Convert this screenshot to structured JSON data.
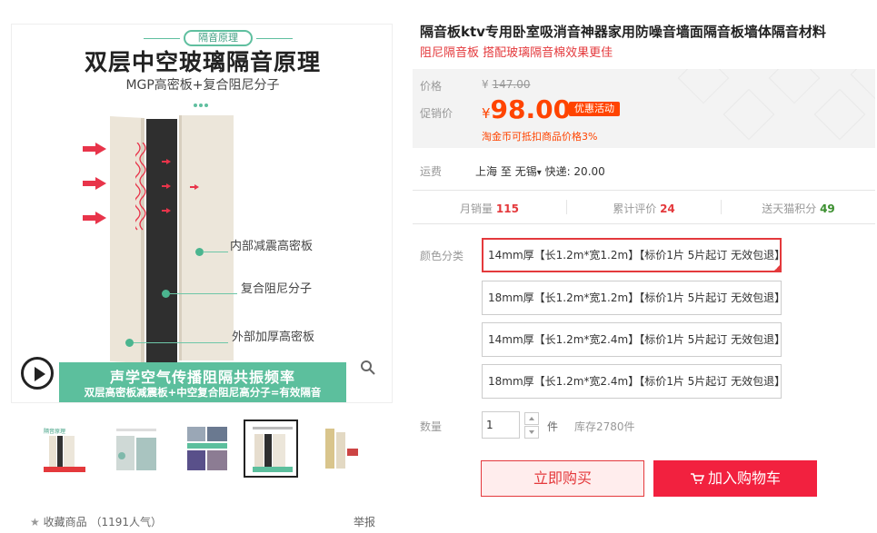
{
  "gallery": {
    "badge": "隔音原理",
    "headline": "双层中空玻璃隔音原理",
    "subheadline": "MGP高密板+复合阻尼分子",
    "labels": [
      "内部减震高密板",
      "复合阻尼分子",
      "外部加厚高密板"
    ],
    "band_line1": "声学空气传播阻隔共振频率",
    "band_line2": "双层高密板减震板+中空复合阻尼高分子=有效隔音",
    "thumb1_caption": "隔音原理",
    "active_thumb_index": 3
  },
  "footer": {
    "favorite_label": "收藏商品",
    "favorite_count": "（1191人气）",
    "report_label": "举报"
  },
  "product": {
    "title": "隔音板ktv专用卧室吸消音神器家用防噪音墙面隔音板墙体隔音材料",
    "subtitle": "阻尼隔音板 搭配玻璃隔音棉效果更佳"
  },
  "price": {
    "original_label": "价格",
    "original_currency": "¥",
    "original_value": "147.00",
    "promo_label": "促销价",
    "currency": "¥",
    "value": "98.00",
    "promo_tag": "优惠活动",
    "coin_note": "淘金币可抵扣商品价格3%"
  },
  "shipping": {
    "label": "运费",
    "from": "上海",
    "to_word": "至",
    "to": "无锡",
    "express": "快递: 20.00"
  },
  "stats": {
    "monthly_sales_label": "月销量",
    "monthly_sales": "115",
    "reviews_label": "累计评价",
    "reviews": "24",
    "points_label": "送天猫积分",
    "points": "49"
  },
  "options": {
    "label": "颜色分类",
    "items": [
      "14mm厚【长1.2m*宽1.2m】【标价1片 5片起订 无效包退】",
      "18mm厚【长1.2m*宽1.2m】【标价1片 5片起订 无效包退】",
      "14mm厚【长1.2m*宽2.4m】【标价1片 5片起订 无效包退】",
      "18mm厚【长1.2m*宽2.4m】【标价1片 5片起订 无效包退】"
    ],
    "selected_index": 0
  },
  "quantity": {
    "label": "数量",
    "value": "1",
    "unit": "件",
    "stock": "库存2780件"
  },
  "actions": {
    "buy_now": "立即购买",
    "add_to_cart": "加入购物车"
  },
  "colors": {
    "accent": "#e4393c",
    "cart": "#f2213f",
    "diagram_green": "#5cbf9d"
  }
}
